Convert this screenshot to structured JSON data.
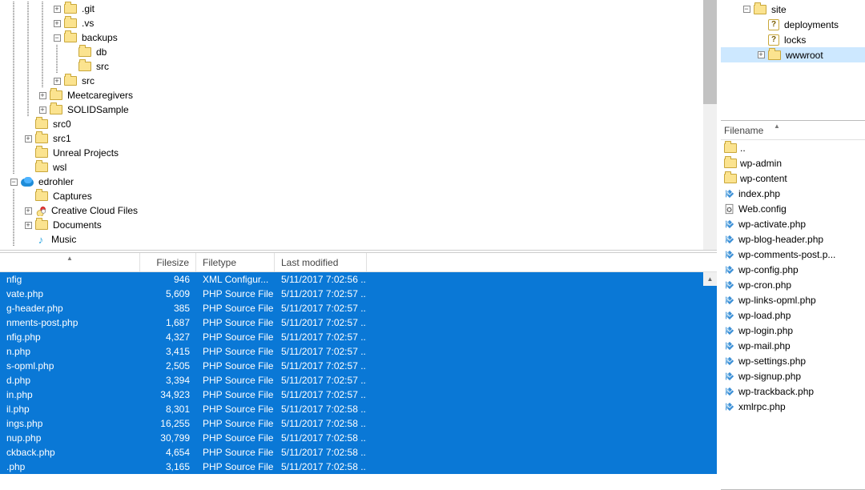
{
  "left_tree": [
    {
      "indent": 4,
      "toggle": "plus",
      "icon": "folder",
      "label": ".git"
    },
    {
      "indent": 4,
      "toggle": "plus",
      "icon": "folder",
      "label": ".vs"
    },
    {
      "indent": 4,
      "toggle": "minus",
      "icon": "folder",
      "label": "backups"
    },
    {
      "indent": 5,
      "toggle": "",
      "icon": "folder",
      "label": "db"
    },
    {
      "indent": 5,
      "toggle": "",
      "icon": "folder",
      "label": "src"
    },
    {
      "indent": 4,
      "toggle": "plus",
      "icon": "folder",
      "label": "src"
    },
    {
      "indent": 3,
      "toggle": "plus",
      "icon": "folder",
      "label": "Meetcaregivers"
    },
    {
      "indent": 3,
      "toggle": "plus",
      "icon": "folder",
      "label": "SOLIDSample"
    },
    {
      "indent": 2,
      "toggle": "",
      "icon": "folder",
      "label": "src0"
    },
    {
      "indent": 2,
      "toggle": "plus",
      "icon": "folder",
      "label": "src1"
    },
    {
      "indent": 2,
      "toggle": "",
      "icon": "folder",
      "label": "Unreal Projects"
    },
    {
      "indent": 2,
      "toggle": "",
      "icon": "folder",
      "label": "wsl"
    },
    {
      "indent": 1,
      "toggle": "minus",
      "icon": "onedrive",
      "label": "edrohler"
    },
    {
      "indent": 2,
      "toggle": "",
      "icon": "folder",
      "label": "Captures"
    },
    {
      "indent": 2,
      "toggle": "plus",
      "icon": "cc",
      "label": "Creative Cloud Files"
    },
    {
      "indent": 2,
      "toggle": "plus",
      "icon": "folder",
      "label": "Documents"
    },
    {
      "indent": 2,
      "toggle": "",
      "icon": "music",
      "label": "Music"
    }
  ],
  "right_tree": [
    {
      "indent": 0,
      "toggle": "minus",
      "icon": "folder",
      "label": "site"
    },
    {
      "indent": 1,
      "toggle": "",
      "icon": "question",
      "label": "deployments"
    },
    {
      "indent": 1,
      "toggle": "",
      "icon": "question",
      "label": "locks"
    },
    {
      "indent": 1,
      "toggle": "plus",
      "icon": "folder",
      "label": "wwwroot",
      "selected": true
    }
  ],
  "left_columns": {
    "name": "",
    "filesize": "Filesize",
    "filetype": "Filetype",
    "last_modified": "Last modified"
  },
  "left_files": [
    {
      "name": "nfig",
      "size": "946",
      "type": "XML Configur...",
      "mod": "5/11/2017 7:02:56 ..."
    },
    {
      "name": "vate.php",
      "size": "5,609",
      "type": "PHP Source File",
      "mod": "5/11/2017 7:02:57 ..."
    },
    {
      "name": "g-header.php",
      "size": "385",
      "type": "PHP Source File",
      "mod": "5/11/2017 7:02:57 ..."
    },
    {
      "name": "nments-post.php",
      "size": "1,687",
      "type": "PHP Source File",
      "mod": "5/11/2017 7:02:57 ..."
    },
    {
      "name": "nfig.php",
      "size": "4,327",
      "type": "PHP Source File",
      "mod": "5/11/2017 7:02:57 ..."
    },
    {
      "name": "n.php",
      "size": "3,415",
      "type": "PHP Source File",
      "mod": "5/11/2017 7:02:57 ..."
    },
    {
      "name": "s-opml.php",
      "size": "2,505",
      "type": "PHP Source File",
      "mod": "5/11/2017 7:02:57 ..."
    },
    {
      "name": "d.php",
      "size": "3,394",
      "type": "PHP Source File",
      "mod": "5/11/2017 7:02:57 ..."
    },
    {
      "name": "in.php",
      "size": "34,923",
      "type": "PHP Source File",
      "mod": "5/11/2017 7:02:57 ..."
    },
    {
      "name": "il.php",
      "size": "8,301",
      "type": "PHP Source File",
      "mod": "5/11/2017 7:02:58 ..."
    },
    {
      "name": "ings.php",
      "size": "16,255",
      "type": "PHP Source File",
      "mod": "5/11/2017 7:02:58 ..."
    },
    {
      "name": "nup.php",
      "size": "30,799",
      "type": "PHP Source File",
      "mod": "5/11/2017 7:02:58 ..."
    },
    {
      "name": "ckback.php",
      "size": "4,654",
      "type": "PHP Source File",
      "mod": "5/11/2017 7:02:58 ..."
    },
    {
      "name": ".php",
      "size": "3,165",
      "type": "PHP Source File",
      "mod": "5/11/2017 7:02:58 ..."
    }
  ],
  "right_columns": {
    "filename": "Filename"
  },
  "right_files": [
    {
      "icon": "folder",
      "label": ".."
    },
    {
      "icon": "folder",
      "label": "wp-admin"
    },
    {
      "icon": "folder",
      "label": "wp-content"
    },
    {
      "icon": "php",
      "label": "index.php"
    },
    {
      "icon": "cfg",
      "label": "Web.config"
    },
    {
      "icon": "php",
      "label": "wp-activate.php"
    },
    {
      "icon": "php",
      "label": "wp-blog-header.php"
    },
    {
      "icon": "php",
      "label": "wp-comments-post.p..."
    },
    {
      "icon": "php",
      "label": "wp-config.php"
    },
    {
      "icon": "php",
      "label": "wp-cron.php"
    },
    {
      "icon": "php",
      "label": "wp-links-opml.php"
    },
    {
      "icon": "php",
      "label": "wp-load.php"
    },
    {
      "icon": "php",
      "label": "wp-login.php"
    },
    {
      "icon": "php",
      "label": "wp-mail.php"
    },
    {
      "icon": "php",
      "label": "wp-settings.php"
    },
    {
      "icon": "php",
      "label": "wp-signup.php"
    },
    {
      "icon": "php",
      "label": "wp-trackback.php"
    },
    {
      "icon": "php",
      "label": "xmlrpc.php"
    }
  ]
}
